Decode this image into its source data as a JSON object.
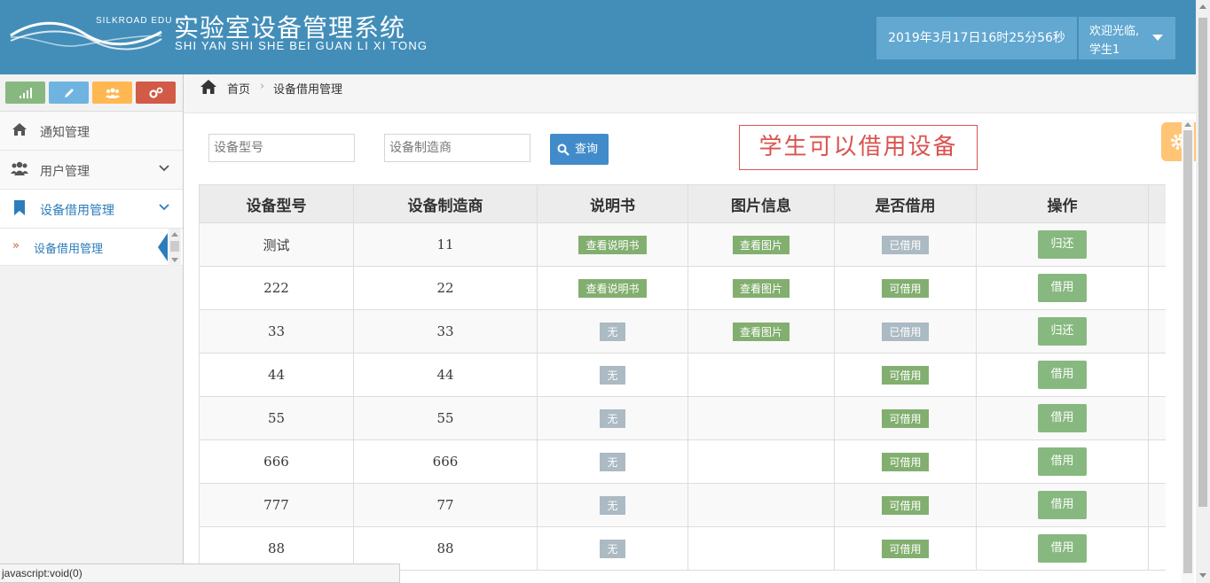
{
  "header": {
    "logo_text": "SILKROAD EDU",
    "title": "实验室设备管理系统",
    "subtitle": "SHI YAN SHI SHE BEI GUAN LI XI TONG",
    "datetime": "2019年3月17日16时25分56秒",
    "welcome": "欢迎光临,",
    "username": "学生1"
  },
  "sidebar": {
    "shortcuts": [
      {
        "icon": "signal-icon",
        "color": "#87b87f"
      },
      {
        "icon": "pencil-icon",
        "color": "#6fb3e0"
      },
      {
        "icon": "users-icon",
        "color": "#ffb752"
      },
      {
        "icon": "cogs-icon",
        "color": "#d15b47"
      }
    ],
    "items": [
      {
        "label": "通知管理",
        "icon": "home-icon"
      },
      {
        "label": "用户管理",
        "icon": "users-icon"
      },
      {
        "label": "设备借用管理",
        "icon": "bookmark-icon"
      }
    ],
    "sub_item": "设备借用管理"
  },
  "breadcrumb": {
    "home": "首页",
    "current": "设备借用管理"
  },
  "search": {
    "model_placeholder": "设备型号",
    "maker_placeholder": "设备制造商",
    "query_label": "查询"
  },
  "notice": "学生可以借用设备",
  "table": {
    "headers": [
      "设备型号",
      "设备制造商",
      "说明书",
      "图片信息",
      "是否借用",
      "操作"
    ],
    "rows": [
      {
        "model": "测试",
        "maker": "11",
        "manual": "查看说明书",
        "manual_available": true,
        "image": "查看图片",
        "status": "已借用",
        "borrowed": true,
        "action": "归还"
      },
      {
        "model": "222",
        "maker": "22",
        "manual": "查看说明书",
        "manual_available": true,
        "image": "查看图片",
        "status": "可借用",
        "borrowed": false,
        "action": "借用"
      },
      {
        "model": "33",
        "maker": "33",
        "manual": "无",
        "manual_available": false,
        "image": "查看图片",
        "status": "已借用",
        "borrowed": true,
        "action": "归还"
      },
      {
        "model": "44",
        "maker": "44",
        "manual": "无",
        "manual_available": false,
        "image": "",
        "status": "可借用",
        "borrowed": false,
        "action": "借用"
      },
      {
        "model": "55",
        "maker": "55",
        "manual": "无",
        "manual_available": false,
        "image": "",
        "status": "可借用",
        "borrowed": false,
        "action": "借用"
      },
      {
        "model": "666",
        "maker": "666",
        "manual": "无",
        "manual_available": false,
        "image": "",
        "status": "可借用",
        "borrowed": false,
        "action": "借用"
      },
      {
        "model": "777",
        "maker": "77",
        "manual": "无",
        "manual_available": false,
        "image": "",
        "status": "可借用",
        "borrowed": false,
        "action": "借用"
      },
      {
        "model": "88",
        "maker": "88",
        "manual": "无",
        "manual_available": false,
        "image": "",
        "status": "可借用",
        "borrowed": false,
        "action": "借用"
      }
    ]
  },
  "status_bar": "javascript:void(0)",
  "colors": {
    "header_bg": "#438eb9",
    "primary": "#428bca",
    "success": "#87b87f",
    "grey": "#abbac3",
    "danger": "#d9534f"
  }
}
